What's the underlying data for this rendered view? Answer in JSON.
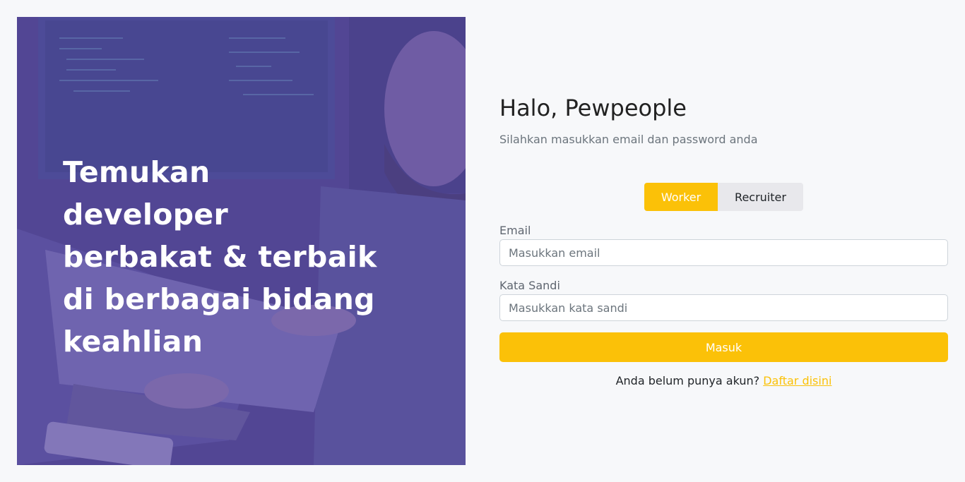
{
  "hero": {
    "headline_lines": [
      "Temukan",
      "developer",
      "berbakat & terbaik",
      "di berbagai bidang",
      "keahlian"
    ],
    "image_desc": "developer-coding-photo"
  },
  "login": {
    "title": "Halo, Pewpeople",
    "subtitle": "Silahkan masukkan email dan password anda",
    "roles": [
      "Worker",
      "Recruiter"
    ],
    "active_role": "Worker",
    "email_label": "Email",
    "email_placeholder": "Masukkan email",
    "password_label": "Kata Sandi",
    "password_placeholder": "Masukkan kata sandi",
    "submit_label": "Masuk",
    "register_prompt": "Anda belum punya akun?",
    "register_link": "Daftar disini"
  },
  "colors": {
    "accent": "#fbc108",
    "hero_overlay": "#5a4ca0",
    "background": "#f7f8fa"
  }
}
